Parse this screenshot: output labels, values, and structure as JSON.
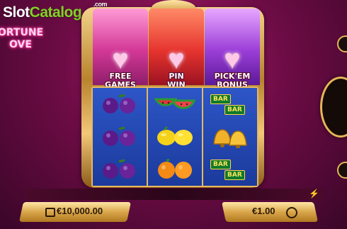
{
  "watermark": {
    "slot": "Slot",
    "catalog": "Catalog",
    "com": ".com"
  },
  "game_title": {
    "line1": "ORTUNE",
    "line2": "OVE"
  },
  "feature_panels": [
    {
      "label_line1": "FREE",
      "label_line2": "GAMES"
    },
    {
      "label_line1": "PIN",
      "label_line2": "WIN"
    },
    {
      "label_line1": "PICK'EM",
      "label_line2": "BONUS"
    }
  ],
  "reels": [
    [
      "plum",
      "plum",
      "plum"
    ],
    [
      "watermelon",
      "lemon",
      "orange"
    ],
    [
      "bar-bar",
      "bells",
      "bar-bar"
    ]
  ],
  "symbols": {
    "bar_text": "BAR",
    "plum": "🍇",
    "watermelon": "🍉",
    "lemon": "🍋",
    "orange": "🍊",
    "bell": "🔔"
  },
  "balance": {
    "value": "€10,000.00",
    "icon": "wallet-icon"
  },
  "bet": {
    "value": "€1.00",
    "icon": "coins-icon"
  },
  "icons": {
    "bolt": "⚡"
  },
  "colors": {
    "background": "#6e0c46",
    "gold": "#e6b557",
    "reel_bg": "#1d3e9e"
  }
}
